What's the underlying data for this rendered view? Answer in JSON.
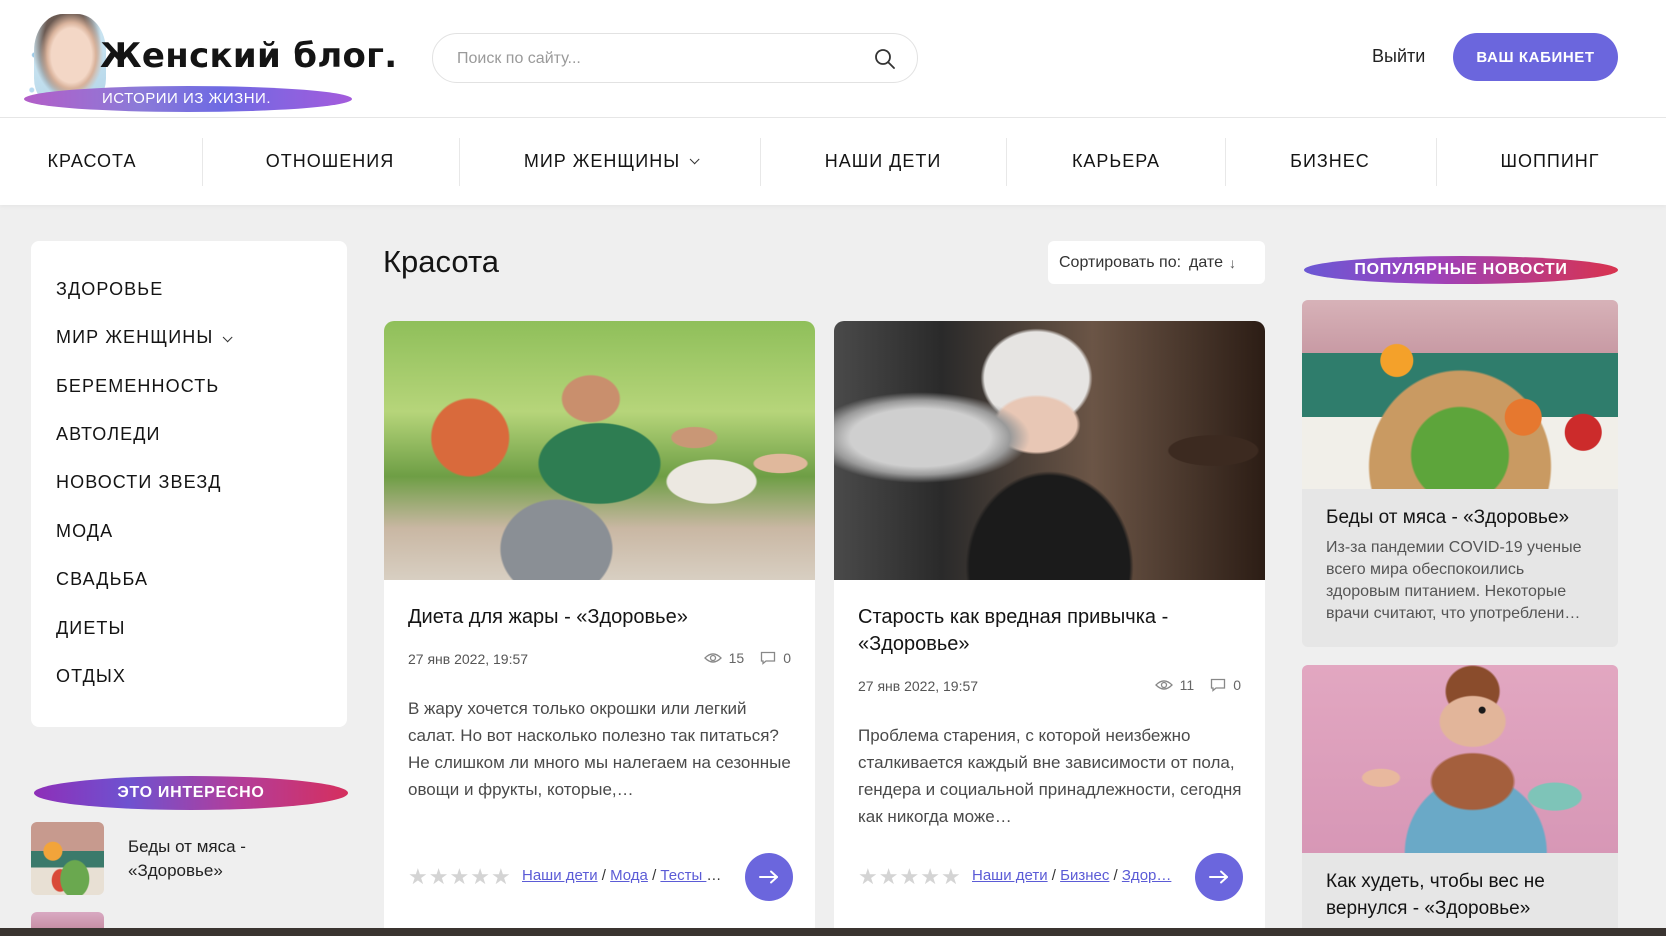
{
  "header": {
    "logo_title": "Женский блог.",
    "logo_tagline": "ИСТОРИИ ИЗ ЖИЗНИ.",
    "search_placeholder": "Поиск по сайту...",
    "logout_label": "Выйти",
    "cabinet_label": "ВАШ КАБИНЕТ"
  },
  "nav": {
    "items": [
      {
        "label": "КРАСОТА"
      },
      {
        "label": "ОТНОШЕНИЯ"
      },
      {
        "label": "МИР ЖЕНЩИНЫ"
      },
      {
        "label": "НАШИ ДЕТИ"
      },
      {
        "label": "КАРЬЕРА"
      },
      {
        "label": "БИЗНЕС"
      },
      {
        "label": "ШОППИНГ"
      }
    ]
  },
  "sidebar": {
    "items": [
      {
        "label": "ЗДОРОВЬЕ"
      },
      {
        "label": "МИР ЖЕНЩИНЫ"
      },
      {
        "label": "БЕРЕМЕННОСТЬ"
      },
      {
        "label": "АВТОЛЕДИ"
      },
      {
        "label": "НОВОСТИ ЗВЕЗД"
      },
      {
        "label": "МОДА"
      },
      {
        "label": "СВАДЬБА"
      },
      {
        "label": "ДИЕТЫ"
      },
      {
        "label": "ОТДЫХ"
      }
    ],
    "interesting_title": "ЭТО ИНТЕРЕСНО",
    "interesting_items": [
      {
        "title": "Беды от мяса - «Здоровье»"
      }
    ]
  },
  "main": {
    "title": "Красота",
    "sort_label": "Сортировать по:",
    "sort_value": "дате",
    "posts": [
      {
        "title": "Диета для жары - «Здоровье»",
        "date": "27 янв 2022, 19:57",
        "views": "15",
        "comments": "0",
        "excerpt": "В жару хочется только окрошки или легкий салат. Но вот насколько полезно так питаться? Не слишком ли много мы налегаем на сезонные овощи и фрукты, которые,…",
        "rating": 0,
        "tags": [
          "Наши дети",
          "Мода",
          "Тесты о…"
        ]
      },
      {
        "title": "Старость как вредная привычка - «Здоровье»",
        "date": "27 янв 2022, 19:57",
        "views": "11",
        "comments": "0",
        "excerpt": "Проблема старения, с которой неизбежно сталкивается каждый вне зависимости от пола, гендера и социальной принадлежности, сегодня как никогда може…",
        "rating": 0,
        "tags": [
          "Наши дети",
          "Бизнес",
          "Здор…"
        ]
      }
    ]
  },
  "popular": {
    "title": "ПОПУЛЯРНЫЕ НОВОСТИ",
    "items": [
      {
        "title": "Беды от мяса - «Здоровье»",
        "excerpt": "Из-за пандемии COVID-19 ученые всего мира обеспокоились здоровым питанием. Некоторые врачи считают, что употреблени…"
      },
      {
        "title": "Как худеть, чтобы вес не вернулся - «Здоровье»"
      }
    ]
  },
  "colors": {
    "accent": "#6b66dd",
    "background": "#efefef",
    "link": "#5b5bd6"
  }
}
